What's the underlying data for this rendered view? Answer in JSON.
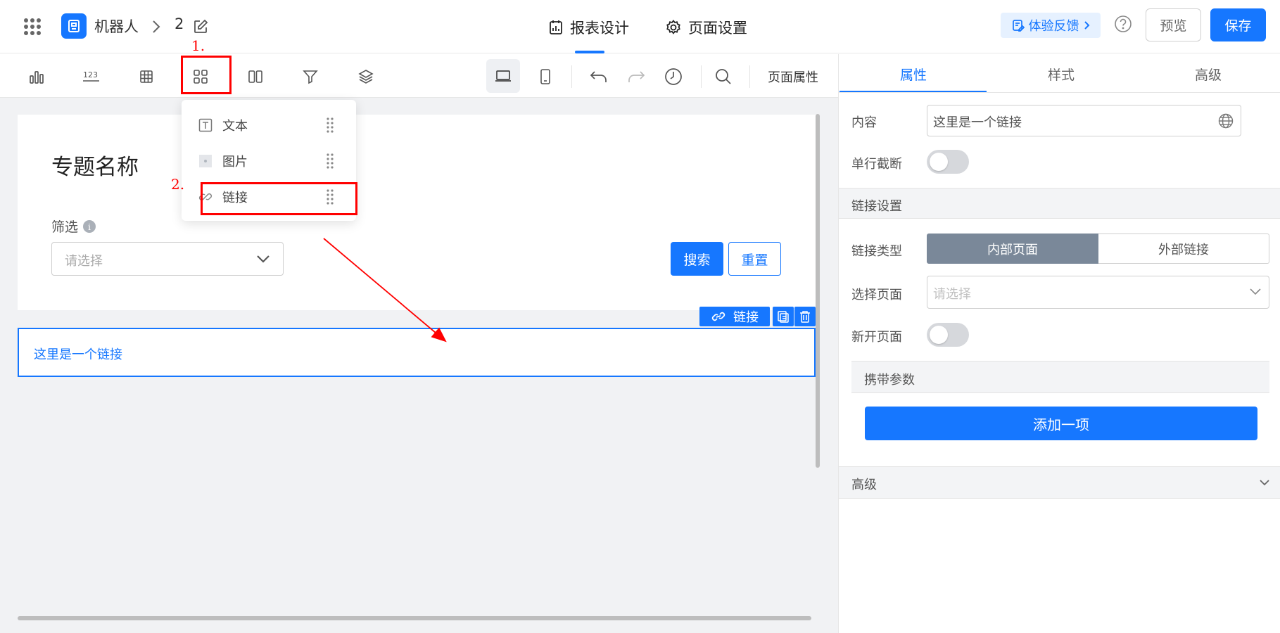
{
  "header": {
    "app_name": "机器人",
    "page_number": "2",
    "tabs": [
      {
        "label": "报表设计"
      },
      {
        "label": "页面设置"
      }
    ],
    "feedback_label": "体验反馈",
    "preview_label": "预览",
    "save_label": "保存"
  },
  "toolbar": {
    "page_props_label": "页面属性",
    "device": "desktop"
  },
  "component_menu": {
    "items": [
      {
        "label": "文本",
        "icon": "text-icon"
      },
      {
        "label": "图片",
        "icon": "image-icon"
      },
      {
        "label": "链接",
        "icon": "link-icon"
      }
    ]
  },
  "canvas": {
    "page_title": "专题名称",
    "filter_label": "筛选",
    "filter_placeholder": "请选择",
    "search_label": "搜索",
    "reset_label": "重置",
    "link_text": "这里是一个链接",
    "selected_component_tag": "链接"
  },
  "annotations": {
    "step1": "1.",
    "step2": "2.",
    "color": "#ff0000"
  },
  "right_panel": {
    "tabs": [
      {
        "label": "属性"
      },
      {
        "label": "样式"
      },
      {
        "label": "高级"
      }
    ],
    "active_tab": "属性",
    "content_label": "内容",
    "content_value": "这里是一个链接",
    "single_line_label": "单行截断",
    "single_line_on": false,
    "link_settings_title": "链接设置",
    "link_type_label": "链接类型",
    "link_type_options": [
      "内部页面",
      "外部链接"
    ],
    "link_type_selected": "内部页面",
    "select_page_label": "选择页面",
    "select_page_placeholder": "请选择",
    "new_page_label": "新开页面",
    "new_page_on": false,
    "params_title": "携带参数",
    "add_item_label": "添加一项",
    "advanced_title": "高级"
  },
  "colors": {
    "primary": "#1677ff",
    "segment_active": "#7a8899",
    "canvas_bg": "#f1f2f4"
  }
}
